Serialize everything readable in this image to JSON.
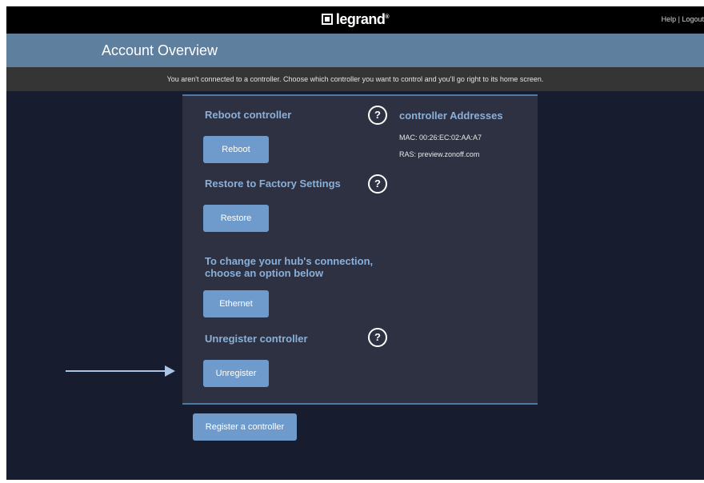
{
  "header": {
    "logo_text": "legrand",
    "logo_trademark": "®",
    "help_label": "Help",
    "separator": " | ",
    "logout_label": "Logout"
  },
  "title_bar": {
    "title": "Account Overview"
  },
  "notice": {
    "text": "You aren't connected to a controller. Choose which controller you want to control and you'll go right to its home screen."
  },
  "panel": {
    "reboot": {
      "heading": "Reboot controller",
      "button": "Reboot",
      "help_icon": "?"
    },
    "addresses": {
      "heading": "controller Addresses",
      "mac": "MAC: 00:26:EC:02:AA:A7",
      "ras": "RAS: preview.zonoff.com"
    },
    "restore": {
      "heading": "Restore to Factory Settings",
      "button": "Restore",
      "help_icon": "?"
    },
    "connection": {
      "heading_line1": "To change your hub's connection,",
      "heading_line2": "choose an option below",
      "button": "Ethernet"
    },
    "unregister": {
      "heading": "Unregister controller",
      "button": "Unregister",
      "help_icon": "?"
    }
  },
  "register_button": "Register a controller",
  "icons": {
    "help": "help-circle-icon",
    "annotation": "arrow-right-icon"
  },
  "colors": {
    "background": "#181c2f",
    "title_bar": "#5e7f9e",
    "notice_bar": "#353535",
    "panel": "#2e3141",
    "accent_text": "#8ab0d9",
    "button": "#6e9bcc",
    "arrow": "#a9c4e4"
  }
}
